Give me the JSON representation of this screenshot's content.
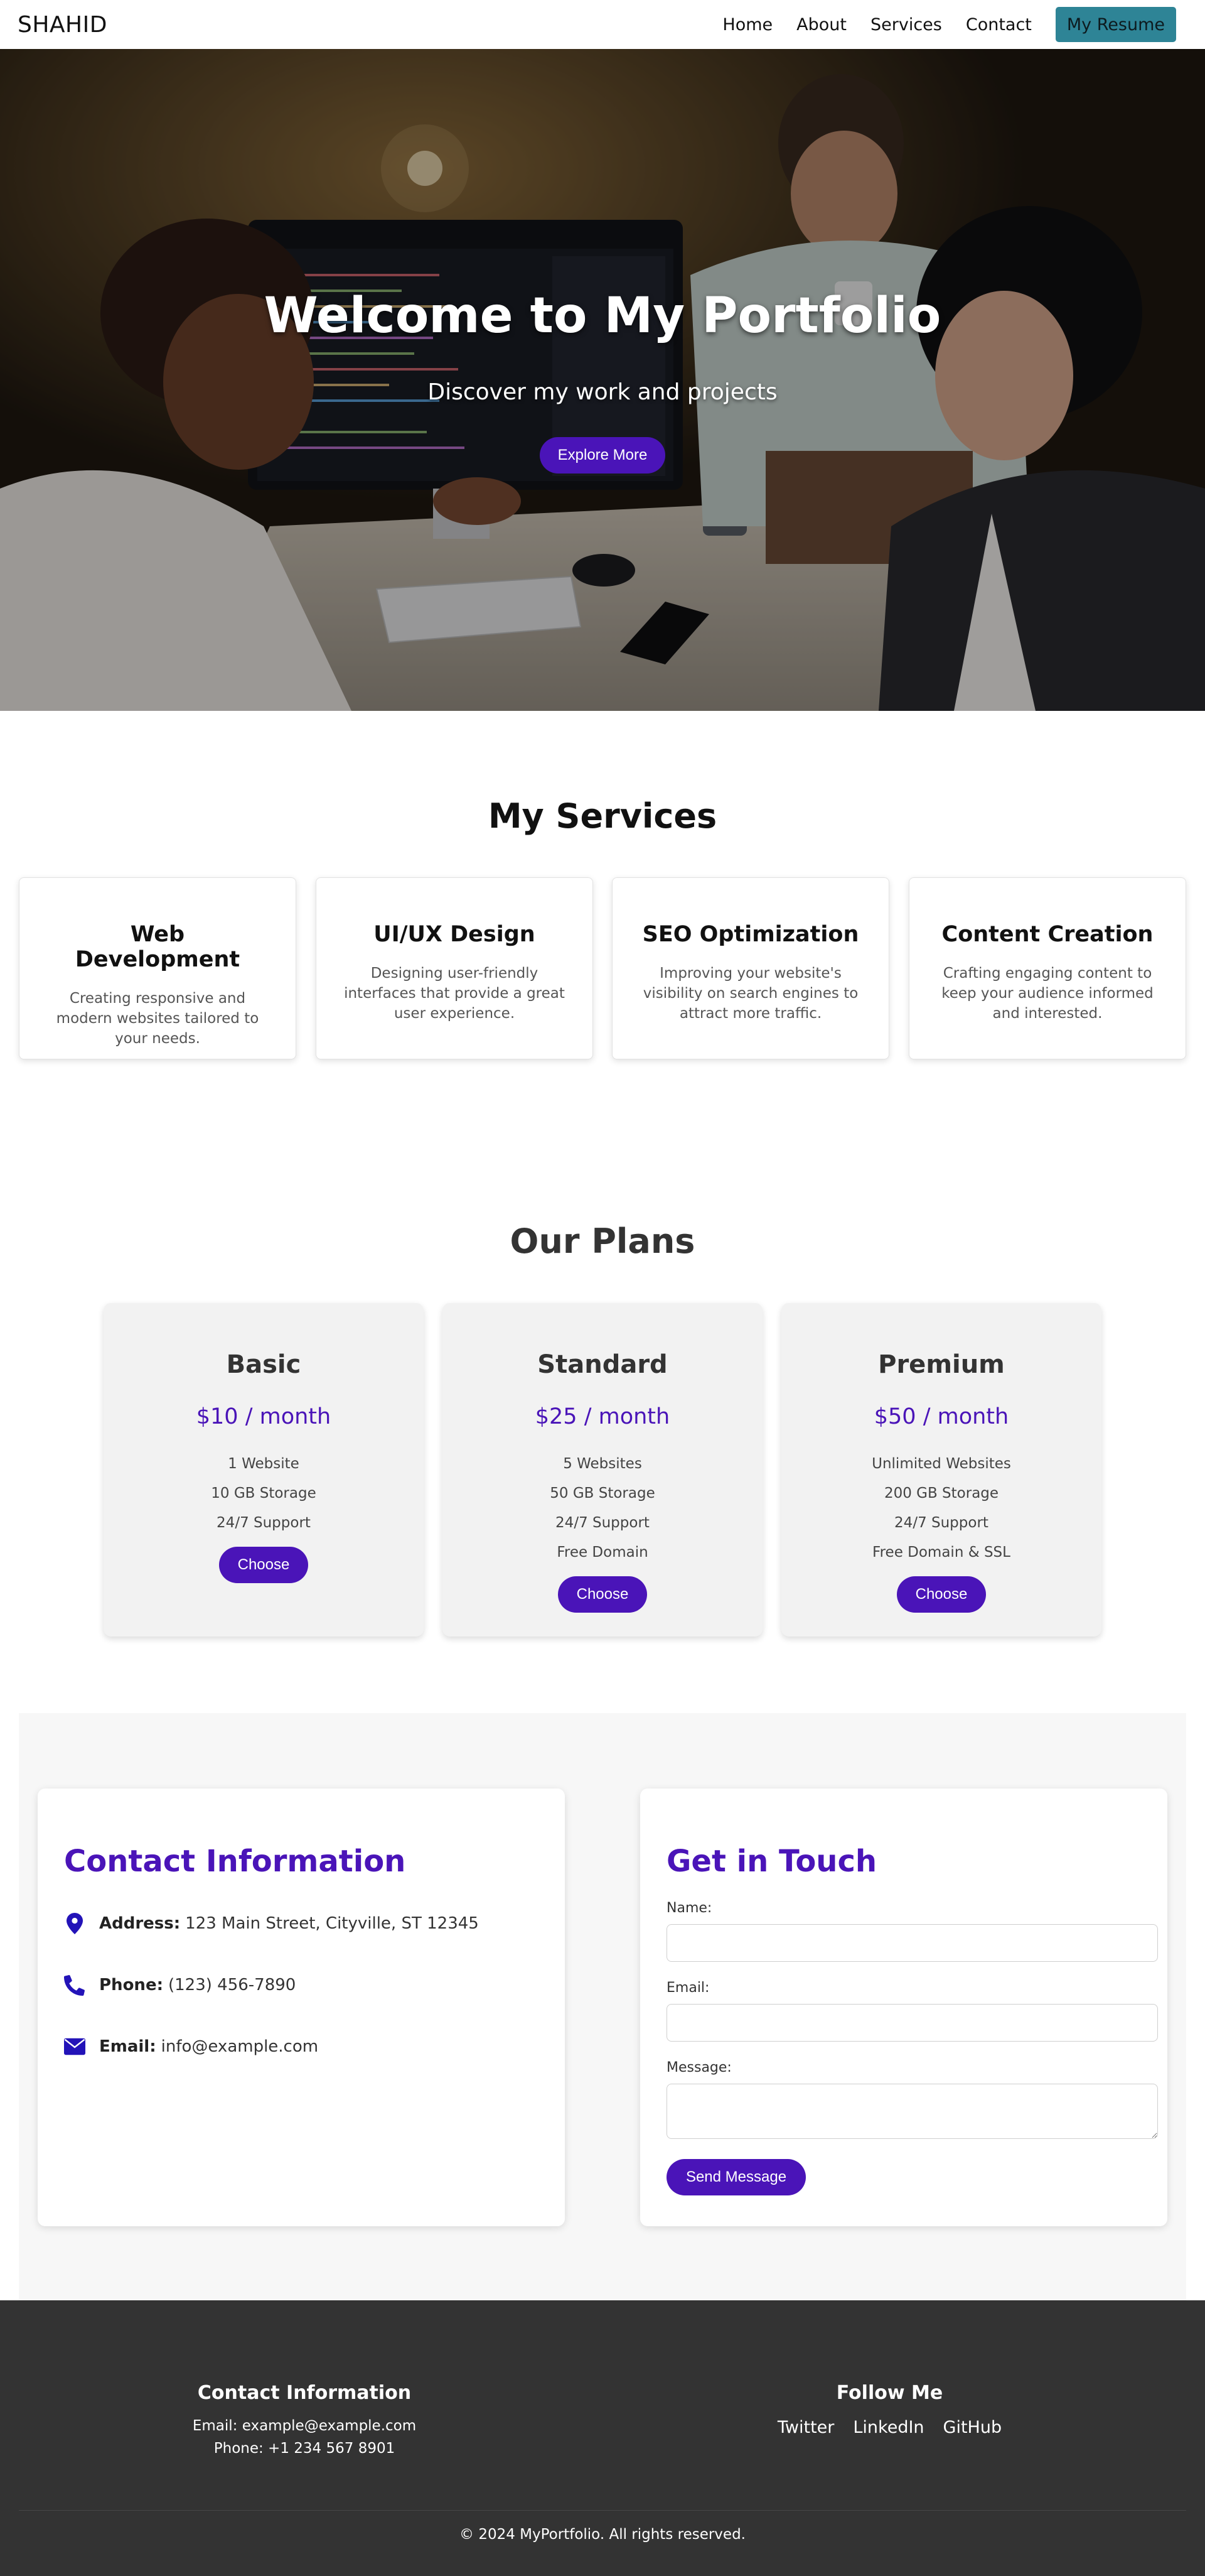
{
  "nav": {
    "brand": "SHAHID",
    "links": [
      "Home",
      "About",
      "Services",
      "Contact"
    ],
    "resume_label": "My Resume",
    "resume_color": "#2e8496"
  },
  "hero": {
    "title": "Welcome to My Portfolio",
    "subtitle": "Discover my work and projects",
    "button_label": "Explore More"
  },
  "services": {
    "title": "My Services",
    "items": [
      {
        "title": "Web Development",
        "description": "Creating responsive and modern websites tailored to your needs."
      },
      {
        "title": "UI/UX Design",
        "description": "Designing user-friendly interfaces that provide a great user experience."
      },
      {
        "title": "SEO Optimization",
        "description": "Improving your website's visibility on search engines to attract more traffic."
      },
      {
        "title": "Content Creation",
        "description": "Crafting engaging content to keep your audience informed and interested."
      }
    ]
  },
  "plans": {
    "title": "Our Plans",
    "accent_color": "#4a14b8",
    "items": [
      {
        "name": "Basic",
        "price": "$10 / month",
        "features": [
          "1 Website",
          "10 GB Storage",
          "24/7 Support"
        ],
        "button_label": "Choose"
      },
      {
        "name": "Standard",
        "price": "$25 / month",
        "features": [
          "5 Websites",
          "50 GB Storage",
          "24/7 Support",
          "Free Domain"
        ],
        "button_label": "Choose"
      },
      {
        "name": "Premium",
        "price": "$50 / month",
        "features": [
          "Unlimited Websites",
          "200 GB Storage",
          "24/7 Support",
          "Free Domain & SSL"
        ],
        "button_label": "Choose"
      }
    ]
  },
  "contact": {
    "info_title": "Contact Information",
    "address_label": "Address:",
    "address_value": "123 Main Street, Cityville, ST 12345",
    "phone_label": "Phone:",
    "phone_value": "(123) 456-7890",
    "email_label": "Email:",
    "email_value": "info@example.com",
    "icons": [
      "map-marker-icon",
      "phone-icon",
      "envelope-icon"
    ],
    "form_title": "Get in Touch",
    "name_label": "Name:",
    "email_field_label": "Email:",
    "message_label": "Message:",
    "name_value": "",
    "email_field_value": "",
    "message_value": "",
    "send_label": "Send Message"
  },
  "footer": {
    "contact_title": "Contact Information",
    "email_line": "Email: example@example.com",
    "phone_line": "Phone: +1 234 567 8901",
    "follow_title": "Follow Me",
    "social_links": [
      "Twitter",
      "LinkedIn",
      "GitHub"
    ],
    "copyright": "© 2024 MyPortfolio. All rights reserved."
  }
}
